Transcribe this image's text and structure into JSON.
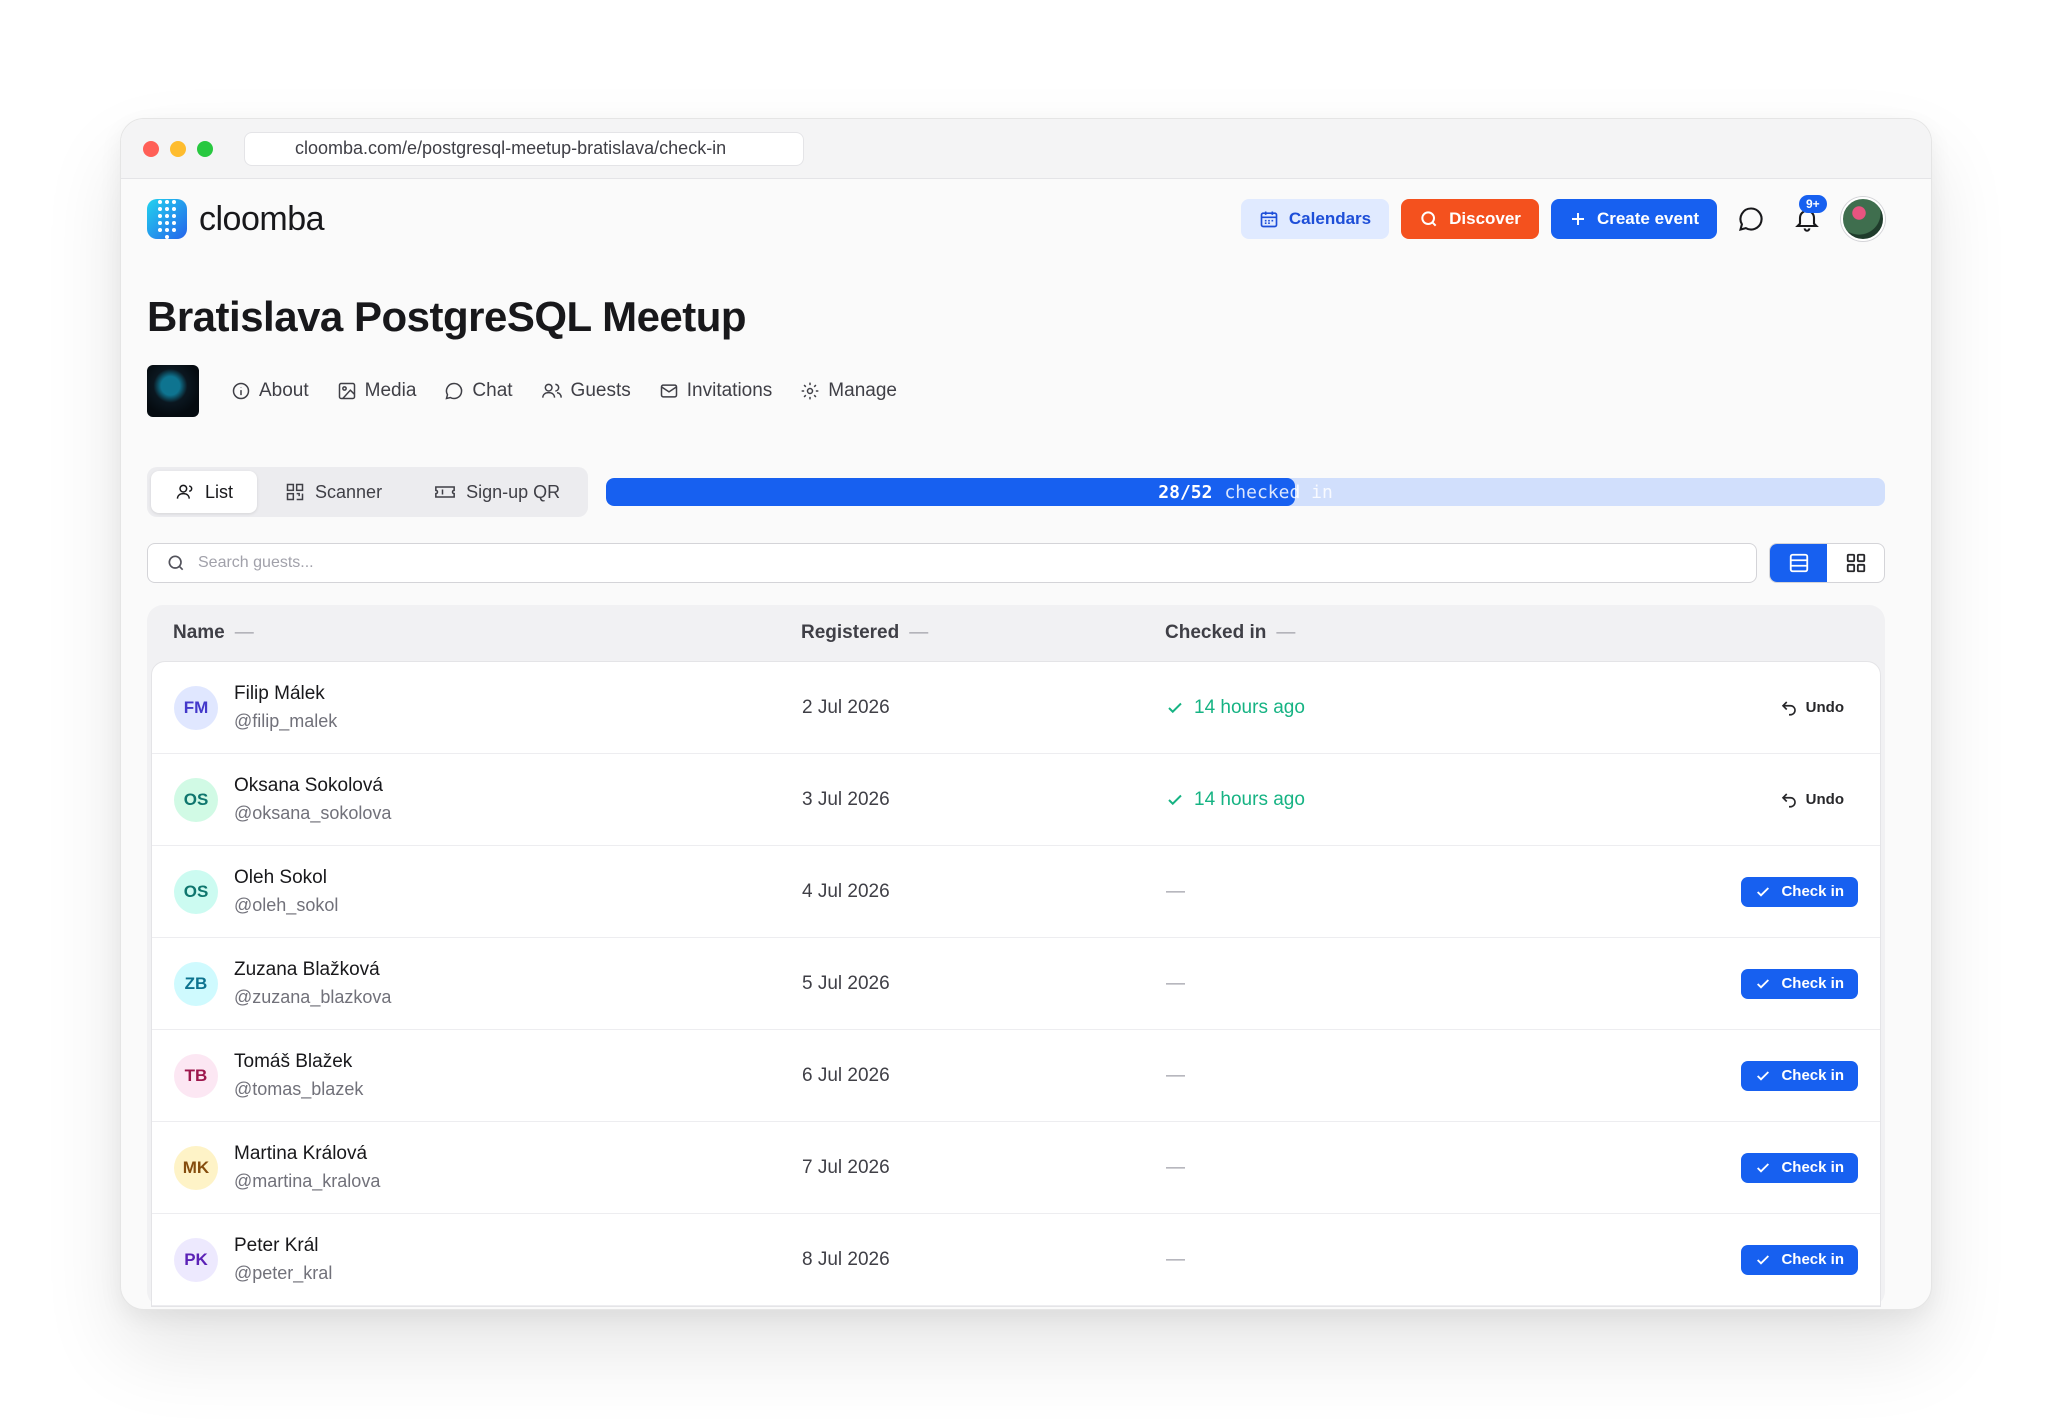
{
  "browser": {
    "url": "cloomba.com/e/postgresql-meetup-bratislava/check-in"
  },
  "header": {
    "logo_text": "cloomba",
    "calendars_label": "Calendars",
    "discover_label": "Discover",
    "create_label": "Create event",
    "notifications_badge": "9+"
  },
  "event": {
    "title": "Bratislava PostgreSQL Meetup"
  },
  "nav": {
    "about": "About",
    "media": "Media",
    "chat": "Chat",
    "guests": "Guests",
    "invitations": "Invitations",
    "manage": "Manage"
  },
  "modes": {
    "list": "List",
    "scanner": "Scanner",
    "signup": "Sign-up QR"
  },
  "progress": {
    "count": "28/52",
    "label": "checked in",
    "checked": 28,
    "total": 52
  },
  "search": {
    "placeholder": "Search guests..."
  },
  "table": {
    "headers": {
      "name": "Name",
      "registered": "Registered",
      "checked_in": "Checked in"
    },
    "rows": [
      {
        "initials": "FM",
        "name": "Filip Málek",
        "handle": "@filip_malek",
        "registered": "2 Jul 2026",
        "checked_in": "14 hours ago",
        "action": "Undo"
      },
      {
        "initials": "OS",
        "name": "Oksana Sokolová",
        "handle": "@oksana_sokolova",
        "registered": "3 Jul 2026",
        "checked_in": "14 hours ago",
        "action": "Undo"
      },
      {
        "initials": "OS",
        "name": "Oleh Sokol",
        "handle": "@oleh_sokol",
        "registered": "4 Jul 2026",
        "checked_in": "—",
        "action": "Check in"
      },
      {
        "initials": "ZB",
        "name": "Zuzana Blažková",
        "handle": "@zuzana_blazkova",
        "registered": "5 Jul 2026",
        "checked_in": "—",
        "action": "Check in"
      },
      {
        "initials": "TB",
        "name": "Tomáš Blažek",
        "handle": "@tomas_blazek",
        "registered": "6 Jul 2026",
        "checked_in": "—",
        "action": "Check in"
      },
      {
        "initials": "MK",
        "name": "Martina Králová",
        "handle": "@martina_kralova",
        "registered": "7 Jul 2026",
        "checked_in": "—",
        "action": "Check in"
      },
      {
        "initials": "PK",
        "name": "Peter Král",
        "handle": "@peter_kral",
        "registered": "8 Jul 2026",
        "checked_in": "—",
        "action": "Check in"
      }
    ]
  },
  "colors": {
    "accent": "#1760f0",
    "discover": "#f4511e",
    "success": "#16b383"
  }
}
